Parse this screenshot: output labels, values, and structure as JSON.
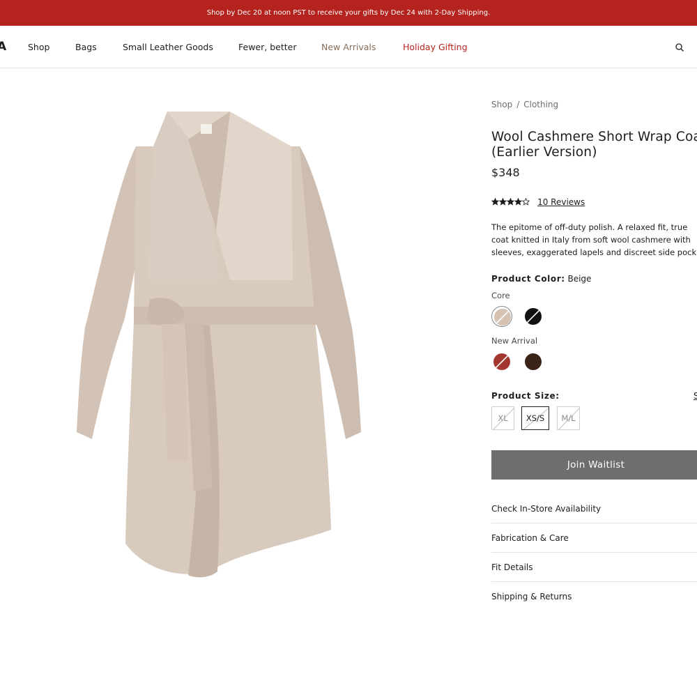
{
  "promo_banner": "Shop by Dec 20 at noon PST to receive your gifts by Dec 24 with 2-Day Shipping.",
  "nav": {
    "logo_glyph": "A",
    "items": [
      "Shop",
      "Bags",
      "Small Leather Goods",
      "Fewer, better",
      "New Arrivals",
      "Holiday Gifting"
    ],
    "search_icon": "search-icon"
  },
  "colors": {
    "promo_bg": "#b5231f",
    "accent_red": "#b5231f",
    "new_arrivals_text": "#8a6d57",
    "waitlist_bg": "#6e6e6e"
  },
  "product": {
    "breadcrumb": [
      "Shop",
      "Clothing"
    ],
    "breadcrumb_separator": "/",
    "title_line1": "Wool Cashmere Short Wrap Coat",
    "title_line2": "(Earlier Version)",
    "price": "$348",
    "rating": {
      "value": 4,
      "max": 5
    },
    "reviews_label": "10 Reviews",
    "description_lines": [
      "The epitome of off-duty polish. A relaxed fit, true",
      "coat knitted in Italy from soft wool cashmere with",
      "sleeves, exaggerated lapels and discreet side pock"
    ],
    "color_label": "Product Color:",
    "color_value": "Beige",
    "color_groups": [
      {
        "label": "Core",
        "swatches": [
          {
            "name": "Beige",
            "hex": "#d6c2b2",
            "selected": true,
            "unavailable": true
          },
          {
            "name": "Black",
            "hex": "#111111",
            "selected": false,
            "unavailable": true
          }
        ]
      },
      {
        "label": "New Arrival",
        "swatches": [
          {
            "name": "Red",
            "hex": "#a3372f",
            "selected": false,
            "unavailable": true
          },
          {
            "name": "Brown",
            "hex": "#3a2418",
            "selected": false,
            "unavailable": false
          }
        ]
      }
    ],
    "size_label": "Product Size:",
    "size_guide": "S",
    "sizes": [
      {
        "label": "XL",
        "selected": false,
        "unavailable": true
      },
      {
        "label": "XS/S",
        "selected": true,
        "unavailable": true
      },
      {
        "label": "M/L",
        "selected": false,
        "unavailable": true
      }
    ],
    "waitlist_button": "Join Waitlist",
    "accordions": [
      "Check In-Store Availability",
      "Fabrication & Care",
      "Fit Details",
      "Shipping & Returns"
    ]
  }
}
